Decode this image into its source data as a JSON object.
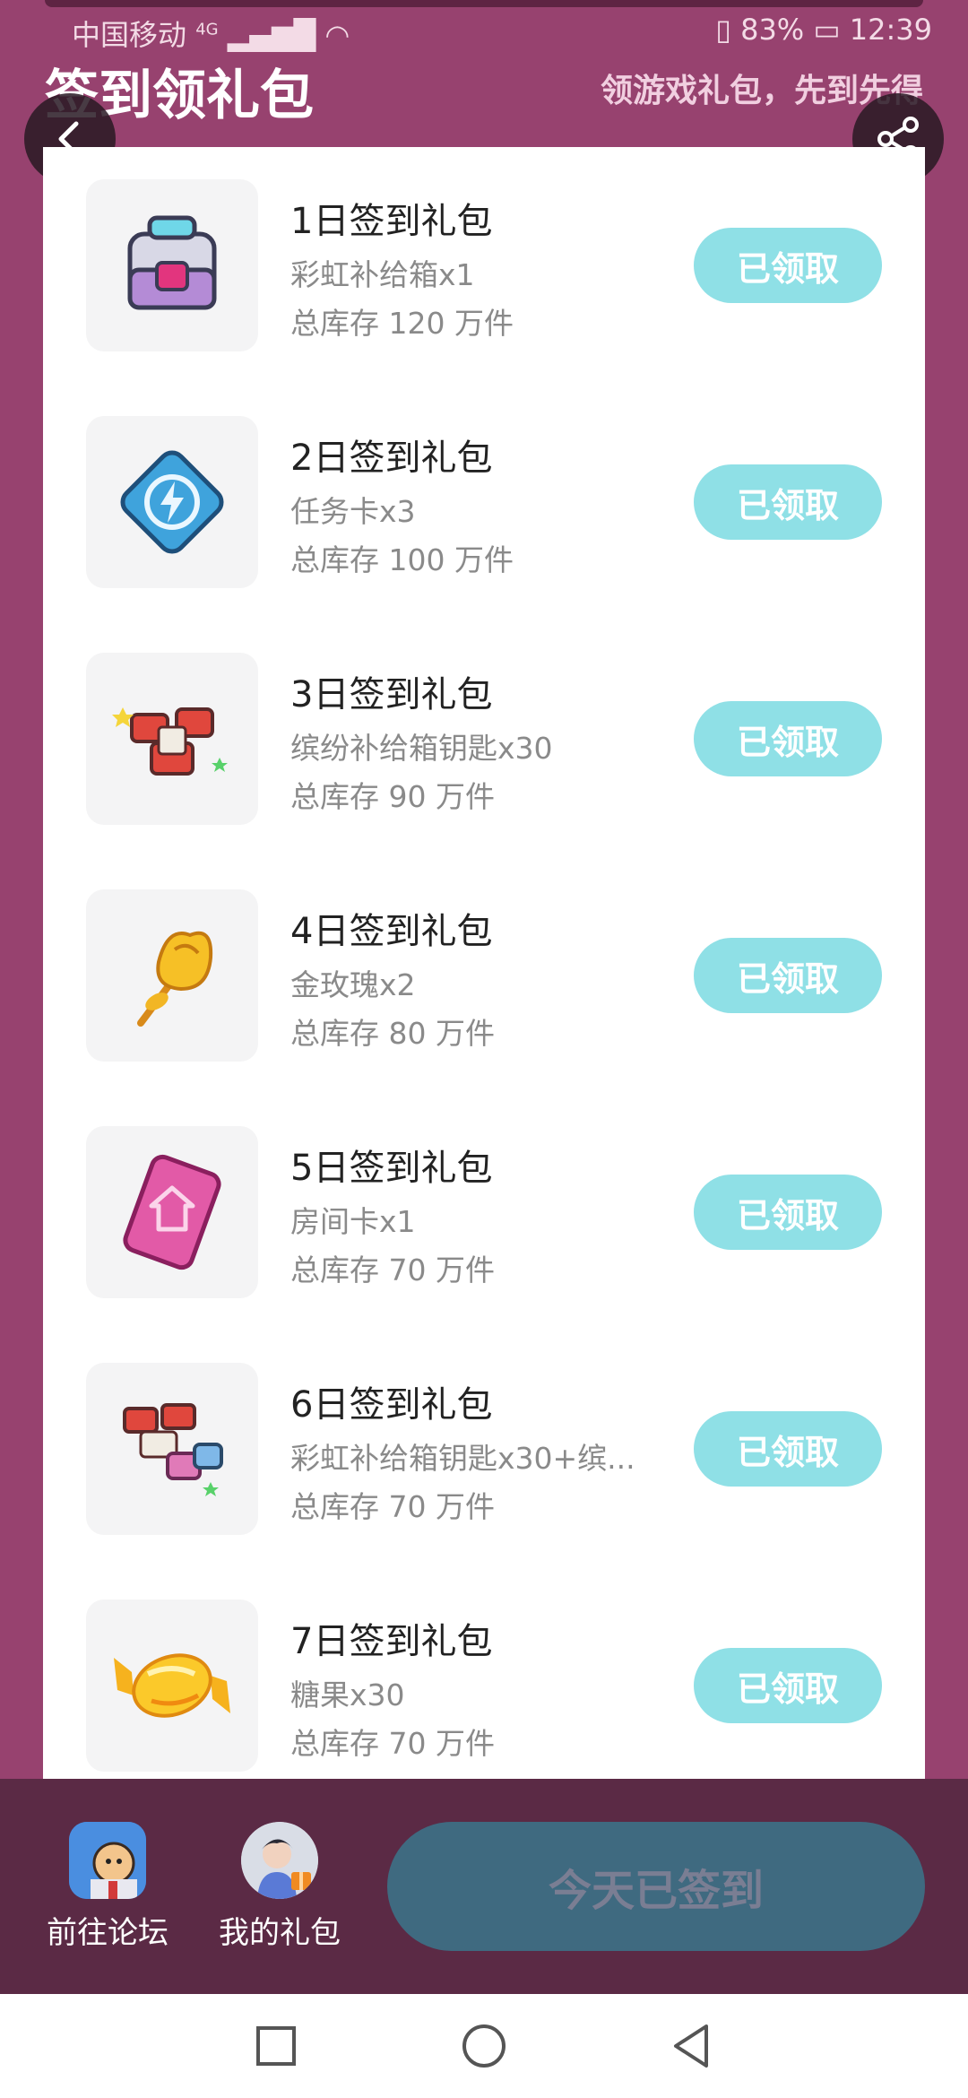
{
  "status_bar": {
    "carrier": "中国移动",
    "network": "4G",
    "battery": "83%",
    "time": "12:39"
  },
  "header": {
    "title": "签到领礼包",
    "subtitle": "领游戏礼包，先到先得"
  },
  "gifts": [
    {
      "title": "1日签到礼包",
      "desc": "彩虹补给箱x1",
      "stock": "总库存 120 万件",
      "button": "已领取",
      "icon": "rainbow-supply-box-icon"
    },
    {
      "title": "2日签到礼包",
      "desc": "任务卡x3",
      "stock": "总库存 100 万件",
      "button": "已领取",
      "icon": "task-card-icon"
    },
    {
      "title": "3日签到礼包",
      "desc": "缤纷补给箱钥匙x30",
      "stock": "总库存 90 万件",
      "button": "已领取",
      "icon": "supply-box-keys-icon"
    },
    {
      "title": "4日签到礼包",
      "desc": "金玫瑰x2",
      "stock": "总库存 80 万件",
      "button": "已领取",
      "icon": "golden-rose-icon"
    },
    {
      "title": "5日签到礼包",
      "desc": "房间卡x1",
      "stock": "总库存 70 万件",
      "button": "已领取",
      "icon": "room-card-icon"
    },
    {
      "title": "6日签到礼包",
      "desc": "彩虹补给箱钥匙x30+缤...",
      "stock": "总库存 70 万件",
      "button": "已领取",
      "icon": "rainbow-keys-bundle-icon"
    },
    {
      "title": "7日签到礼包",
      "desc": "糖果x30",
      "stock": "总库存 70 万件",
      "button": "已领取",
      "icon": "candy-icon"
    }
  ],
  "bottom_bar": {
    "forum_label": "前往论坛",
    "my_gifts_label": "我的礼包",
    "signed_label": "今天已签到"
  },
  "colors": {
    "background": "#97426f",
    "claimed_button": "#8fe0e6",
    "bottom_bar": "#5b2a45",
    "signed_button": "#3f6a80"
  }
}
